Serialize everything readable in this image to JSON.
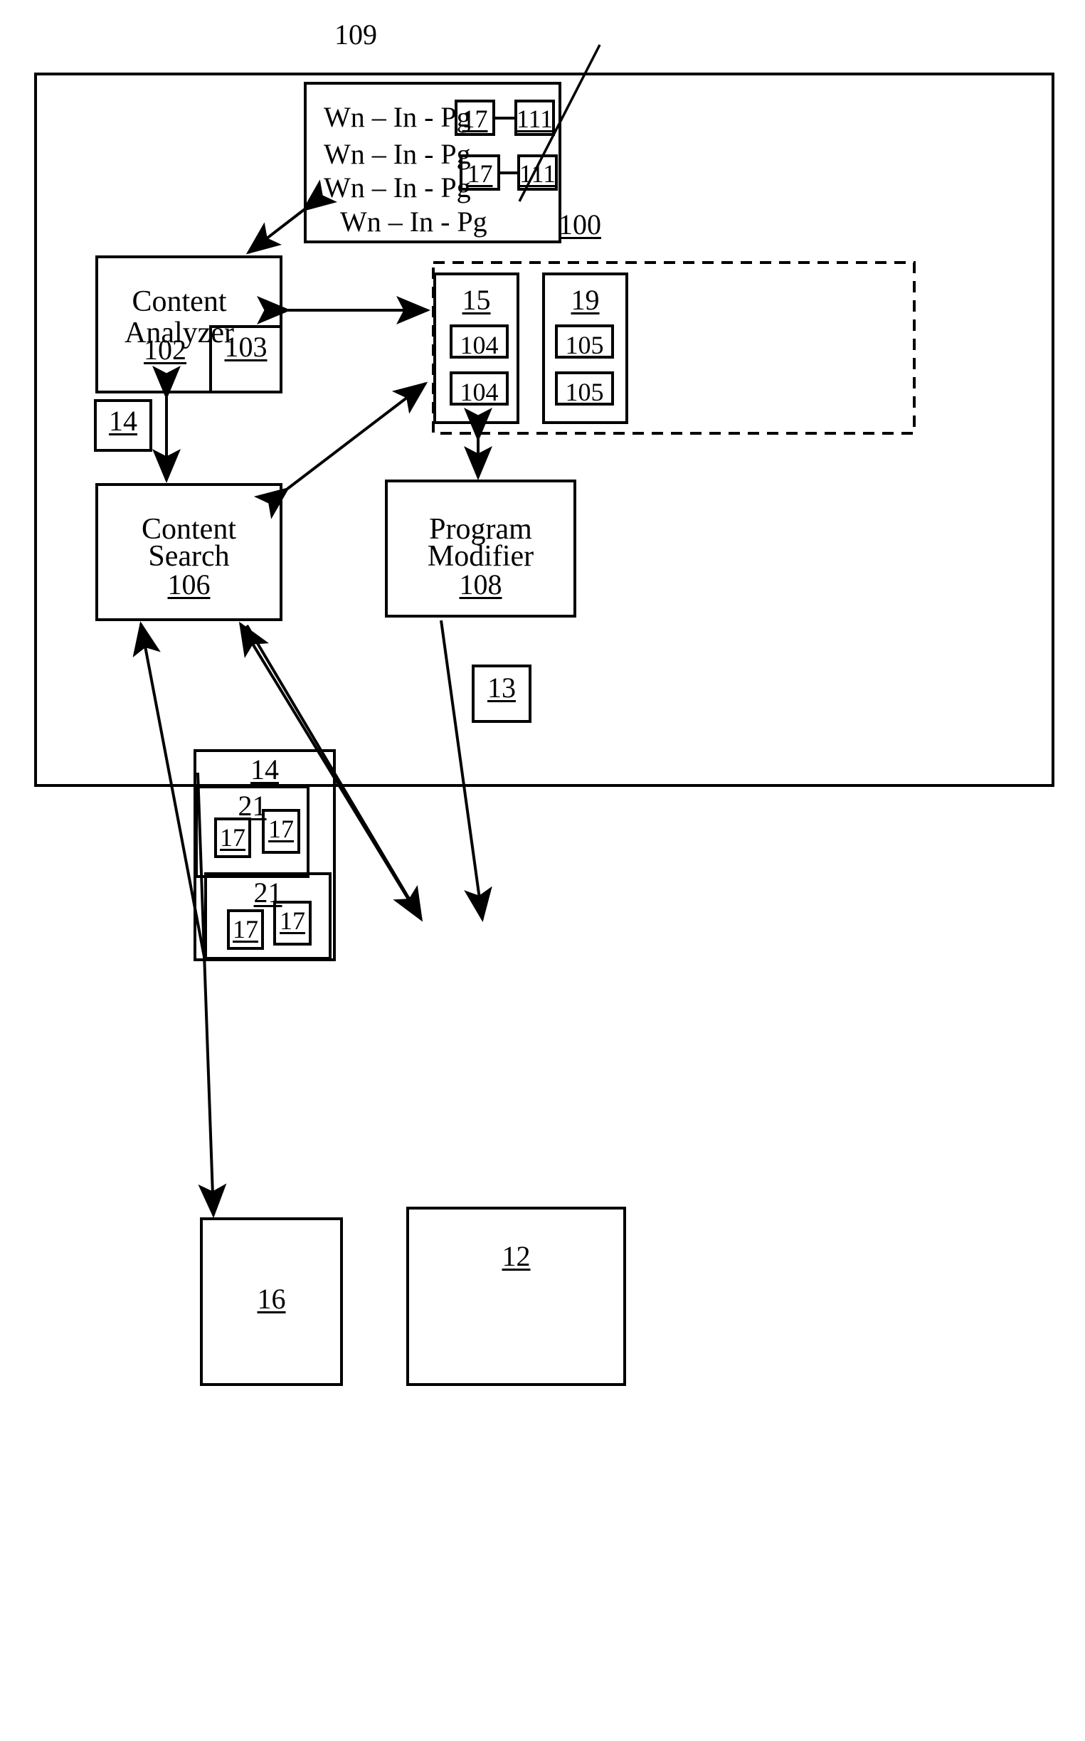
{
  "figure": {
    "lead_label": "109",
    "system_label": "100"
  },
  "content_list_box": {
    "lines": [
      {
        "text": "Wn – In - Pg",
        "ref_left": "17",
        "ref_right": "111"
      },
      {
        "text": "Wn – In - Pg",
        "ref_left": "",
        "ref_right": ""
      },
      {
        "text": "Wn – In - Pg",
        "ref_left": "17",
        "ref_right": "111"
      },
      {
        "text": "Wn – In - Pg",
        "ref_left": "",
        "ref_right": ""
      }
    ]
  },
  "blocks": {
    "content_analyzer": {
      "line1": "Content",
      "line2": "Analyzer",
      "ref": "102"
    },
    "analyzer_sub": {
      "ref": "103"
    },
    "analyzer_side": {
      "ref": "14"
    },
    "content_search": {
      "line1": "Content",
      "line2": "Search",
      "ref": "106"
    },
    "program_modifier": {
      "line1": "Program",
      "line2": "Modifier",
      "ref": "108"
    },
    "program_side": {
      "ref": "13"
    },
    "store_left": {
      "ref": "15",
      "items": [
        "104",
        "104"
      ]
    },
    "store_right": {
      "ref": "19",
      "items": [
        "105",
        "105"
      ]
    },
    "source_group": {
      "ref": "14",
      "groups": [
        {
          "ref": "21",
          "items": [
            "17",
            "17"
          ]
        },
        {
          "ref": "21",
          "items": [
            "17",
            "17"
          ]
        }
      ]
    },
    "output_left": {
      "ref": "16"
    },
    "output_right": {
      "ref": "12"
    }
  },
  "colors": {
    "stroke": "#000000",
    "background": "#ffffff"
  }
}
